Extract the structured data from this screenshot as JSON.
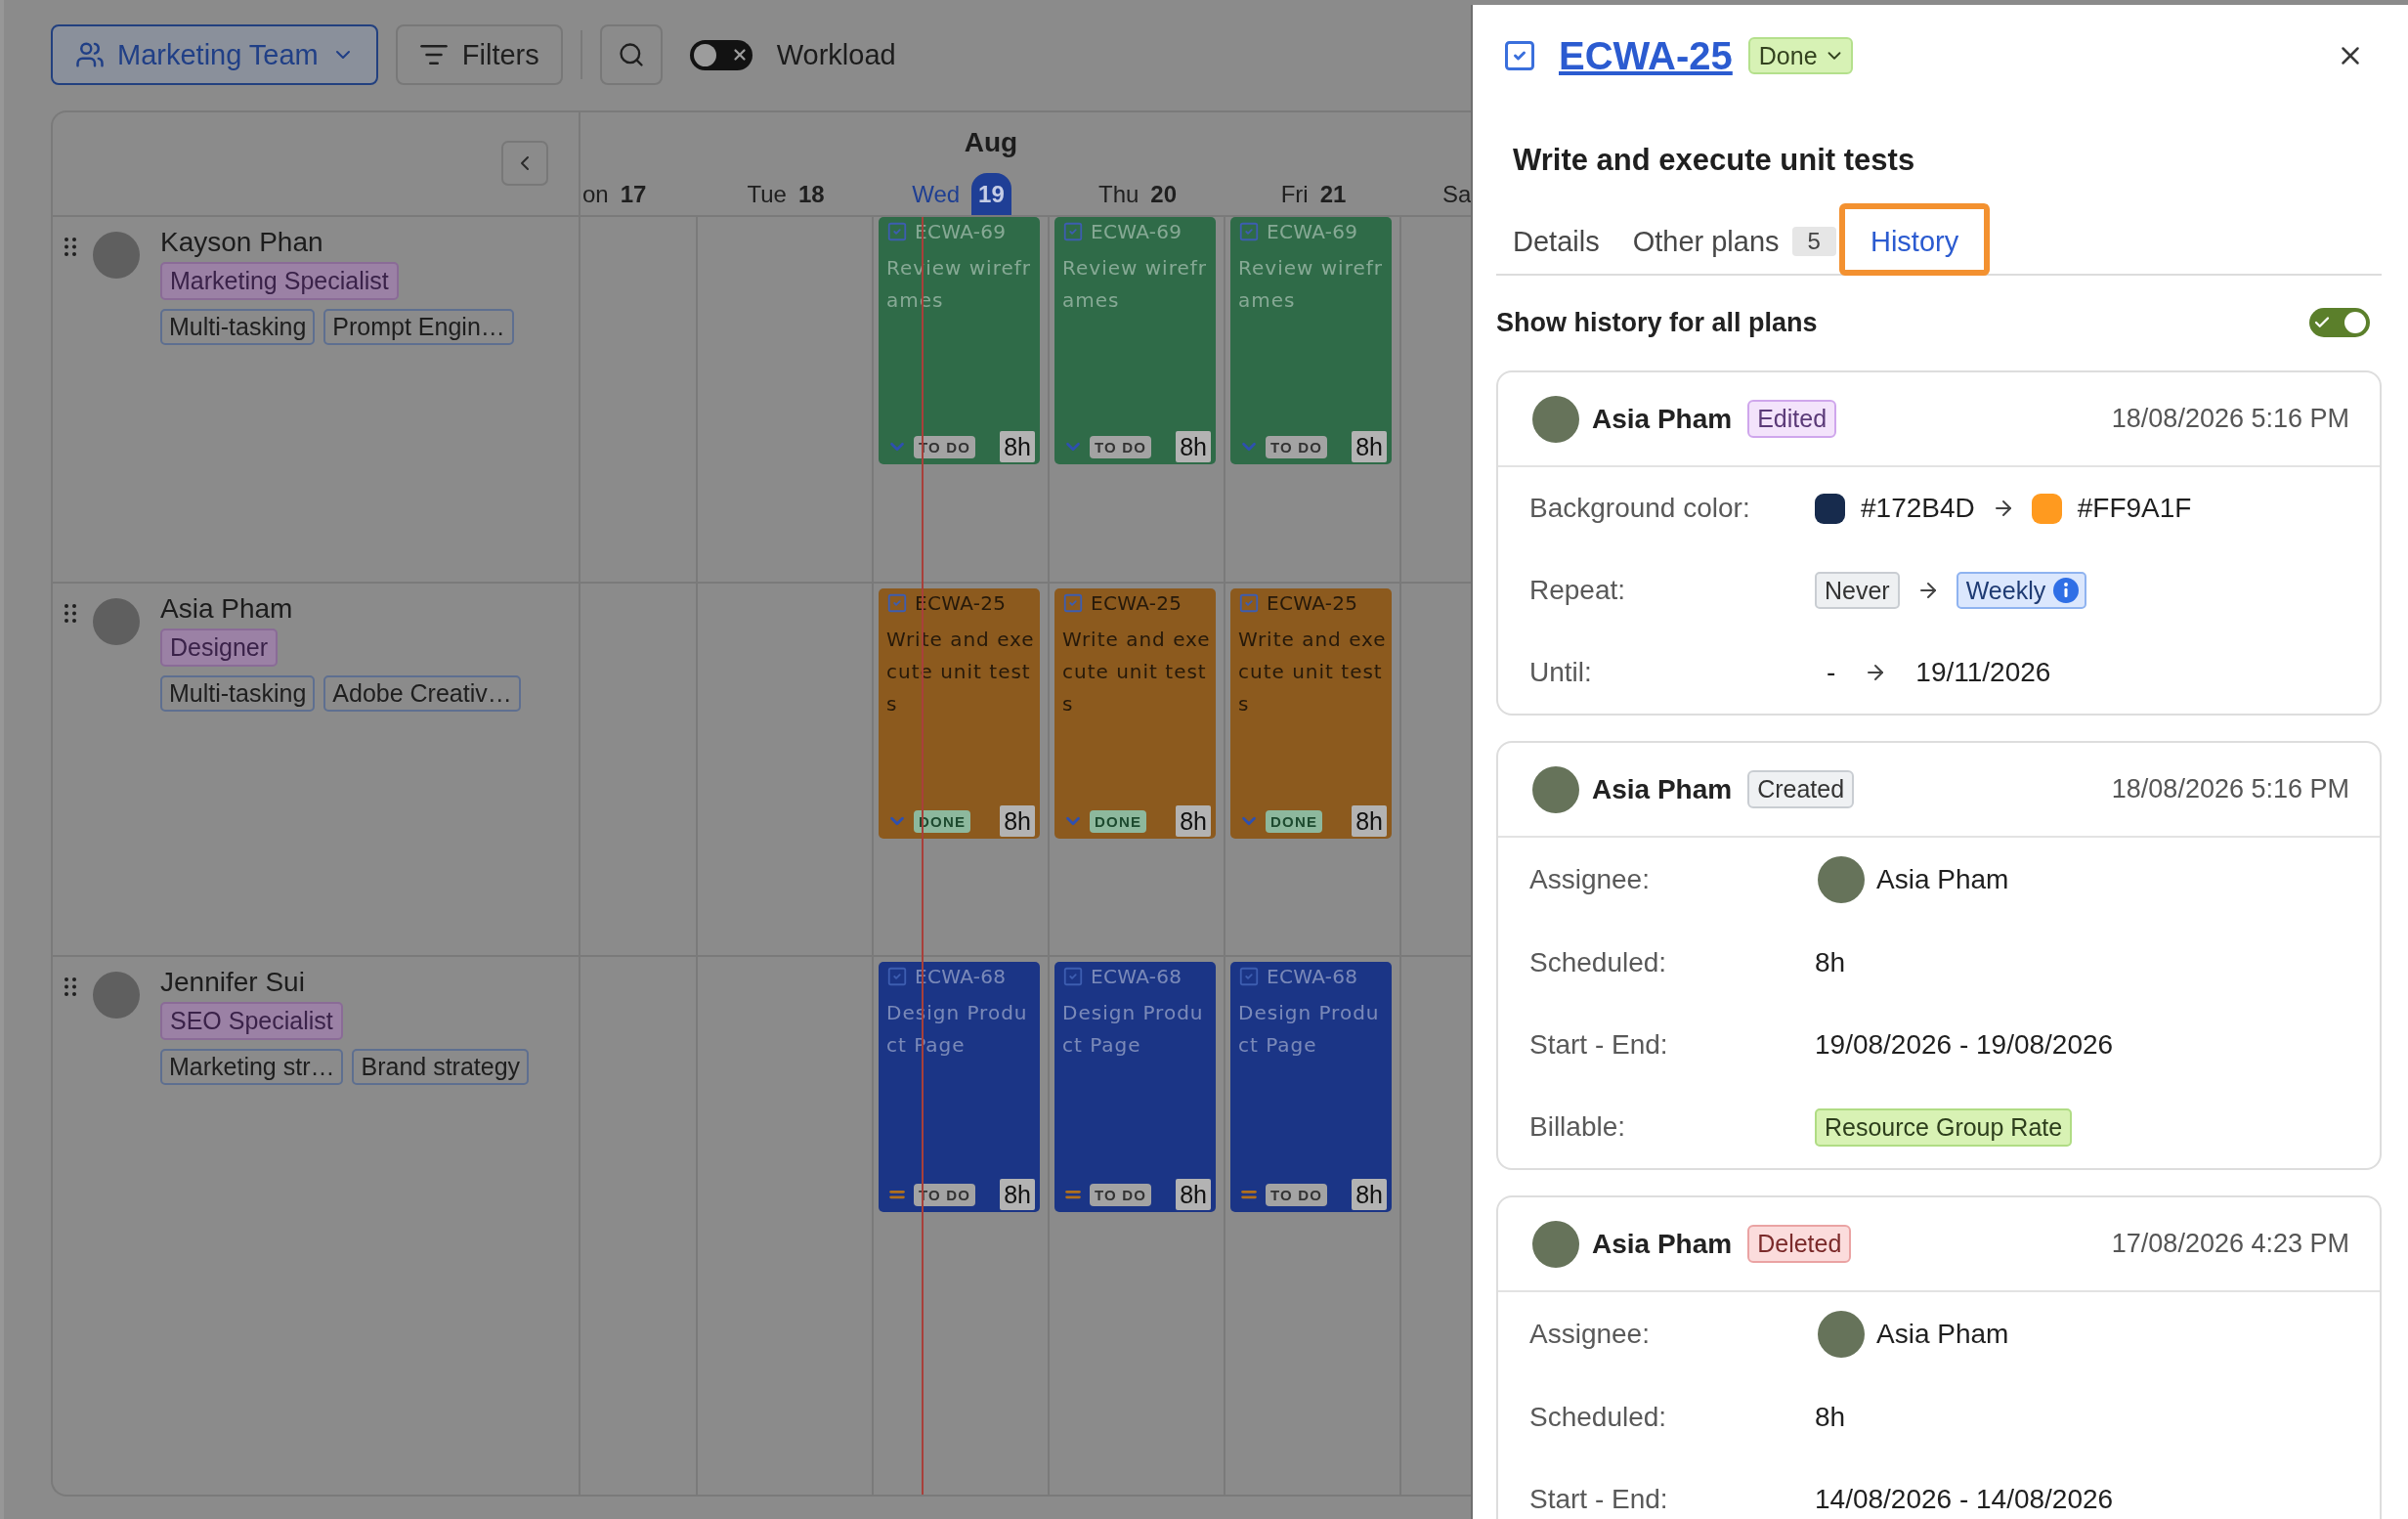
{
  "toolbar": {
    "team_selector": {
      "label": "Marketing Team"
    },
    "filters_button": {
      "label": "Filters"
    },
    "workload_toggle": {
      "label": "Workload",
      "on": false
    }
  },
  "scheduler": {
    "month": "Aug",
    "days": [
      {
        "weekday": "on",
        "date": "17",
        "today": false
      },
      {
        "weekday": "Tue",
        "date": "18",
        "today": false
      },
      {
        "weekday": "Wed",
        "date": "19",
        "today": true
      },
      {
        "weekday": "Thu",
        "date": "20",
        "today": false
      },
      {
        "weekday": "Fri",
        "date": "21",
        "today": false
      },
      {
        "weekday": "Sa",
        "today": false
      }
    ],
    "people": [
      {
        "name": "Kayson Phan",
        "role": "Marketing Specialist",
        "skills": [
          "Multi-tasking",
          "Prompt Engin…"
        ],
        "cells": [
          {
            "kind": "empty"
          },
          {
            "kind": "empty"
          },
          {
            "kind": "task",
            "key": "ECWA-69",
            "title": "Review wireframes",
            "status": "TO DO",
            "done": false,
            "medium_priority": false,
            "hours": "8h",
            "color": "#2f6b48"
          },
          {
            "kind": "task",
            "key": "ECWA-69",
            "title": "Review wireframes",
            "status": "TO DO",
            "done": false,
            "medium_priority": false,
            "hours": "8h",
            "color": "#2f6b48"
          },
          {
            "kind": "task",
            "key": "ECWA-69",
            "title": "Review wireframes",
            "status": "TO DO",
            "done": false,
            "medium_priority": false,
            "hours": "8h",
            "color": "#2f6b48"
          },
          {
            "kind": "empty"
          }
        ]
      },
      {
        "name": "Asia Pham",
        "role": "Designer",
        "skills": [
          "Multi-tasking",
          "Adobe Creativ…"
        ],
        "cells": [
          {
            "kind": "empty"
          },
          {
            "kind": "empty"
          },
          {
            "kind": "task",
            "key": "ECWA-25",
            "title": "Write and execute unit tests",
            "status": "DONE",
            "done": true,
            "medium_priority": false,
            "hours": "8h",
            "color": "#8c5a1e"
          },
          {
            "kind": "task",
            "key": "ECWA-25",
            "title": "Write and execute unit tests",
            "status": "DONE",
            "done": true,
            "medium_priority": false,
            "hours": "8h",
            "color": "#8c5a1e"
          },
          {
            "kind": "task",
            "key": "ECWA-25",
            "title": "Write and execute unit tests",
            "status": "DONE",
            "done": true,
            "medium_priority": false,
            "hours": "8h",
            "color": "#8c5a1e"
          },
          {
            "kind": "empty"
          }
        ]
      },
      {
        "name": "Jennifer Sui",
        "role": "SEO Specialist",
        "skills": [
          "Marketing str…",
          "Brand strategy"
        ],
        "cells": [
          {
            "kind": "empty"
          },
          {
            "kind": "empty"
          },
          {
            "kind": "task",
            "key": "ECWA-68",
            "title": "Design Product Page",
            "status": "TO DO",
            "done": false,
            "medium_priority": true,
            "hours": "8h",
            "color": "#1b3586"
          },
          {
            "kind": "task",
            "key": "ECWA-68",
            "title": "Design Product Page",
            "status": "TO DO",
            "done": false,
            "medium_priority": true,
            "hours": "8h",
            "color": "#1b3586"
          },
          {
            "kind": "task",
            "key": "ECWA-68",
            "title": "Design Product Page",
            "status": "TO DO",
            "done": false,
            "medium_priority": true,
            "hours": "8h",
            "color": "#1b3586"
          },
          {
            "kind": "empty"
          }
        ]
      }
    ]
  },
  "detail_panel": {
    "key": "ECWA-25",
    "status": "Done",
    "title": "Write and execute unit tests",
    "tabs": [
      {
        "label": "Details",
        "selected": false,
        "highlighted": false
      },
      {
        "label": "Other plans",
        "count": "5",
        "selected": false,
        "highlighted": false
      },
      {
        "label": "History",
        "selected": true,
        "highlighted": true
      }
    ],
    "history_toggle": {
      "label": "Show history for all plans",
      "on": true
    },
    "history": [
      {
        "kind": "edited",
        "user": "Asia Pham",
        "action": "Edited",
        "time": "18/08/2026 5:16 PM",
        "changes": [
          {
            "kind": "color",
            "label": "Background color:",
            "from": {
              "text": "#172B4D",
              "color": "#172b4d"
            },
            "to": {
              "text": "#FF9A1F",
              "color": "#ff9a1f"
            }
          },
          {
            "kind": "tags",
            "label": "Repeat:",
            "from": "Never",
            "to": "Weekly"
          },
          {
            "kind": "change",
            "label": "Until:",
            "from": "-",
            "to": "19/11/2026"
          }
        ]
      },
      {
        "kind": "created",
        "user": "Asia Pham",
        "action": "Created",
        "time": "18/08/2026 5:16 PM",
        "changes": [
          {
            "kind": "user",
            "label": "Assignee:",
            "value": "Asia Pham"
          },
          {
            "kind": "text",
            "label": "Scheduled:",
            "value": "8h"
          },
          {
            "kind": "text",
            "label": "Start - End:",
            "value": "19/08/2026 - 19/08/2026"
          },
          {
            "kind": "tag",
            "label": "Billable:",
            "value": "Resource Group Rate"
          }
        ]
      },
      {
        "kind": "deleted",
        "user": "Asia Pham",
        "action": "Deleted",
        "time": "17/08/2026 4:23 PM",
        "changes": [
          {
            "kind": "user",
            "label": "Assignee:",
            "value": "Asia Pham"
          },
          {
            "kind": "text",
            "label": "Scheduled:",
            "value": "8h"
          },
          {
            "kind": "text",
            "label": "Start - End:",
            "value": "14/08/2026 - 14/08/2026"
          }
        ]
      }
    ]
  }
}
